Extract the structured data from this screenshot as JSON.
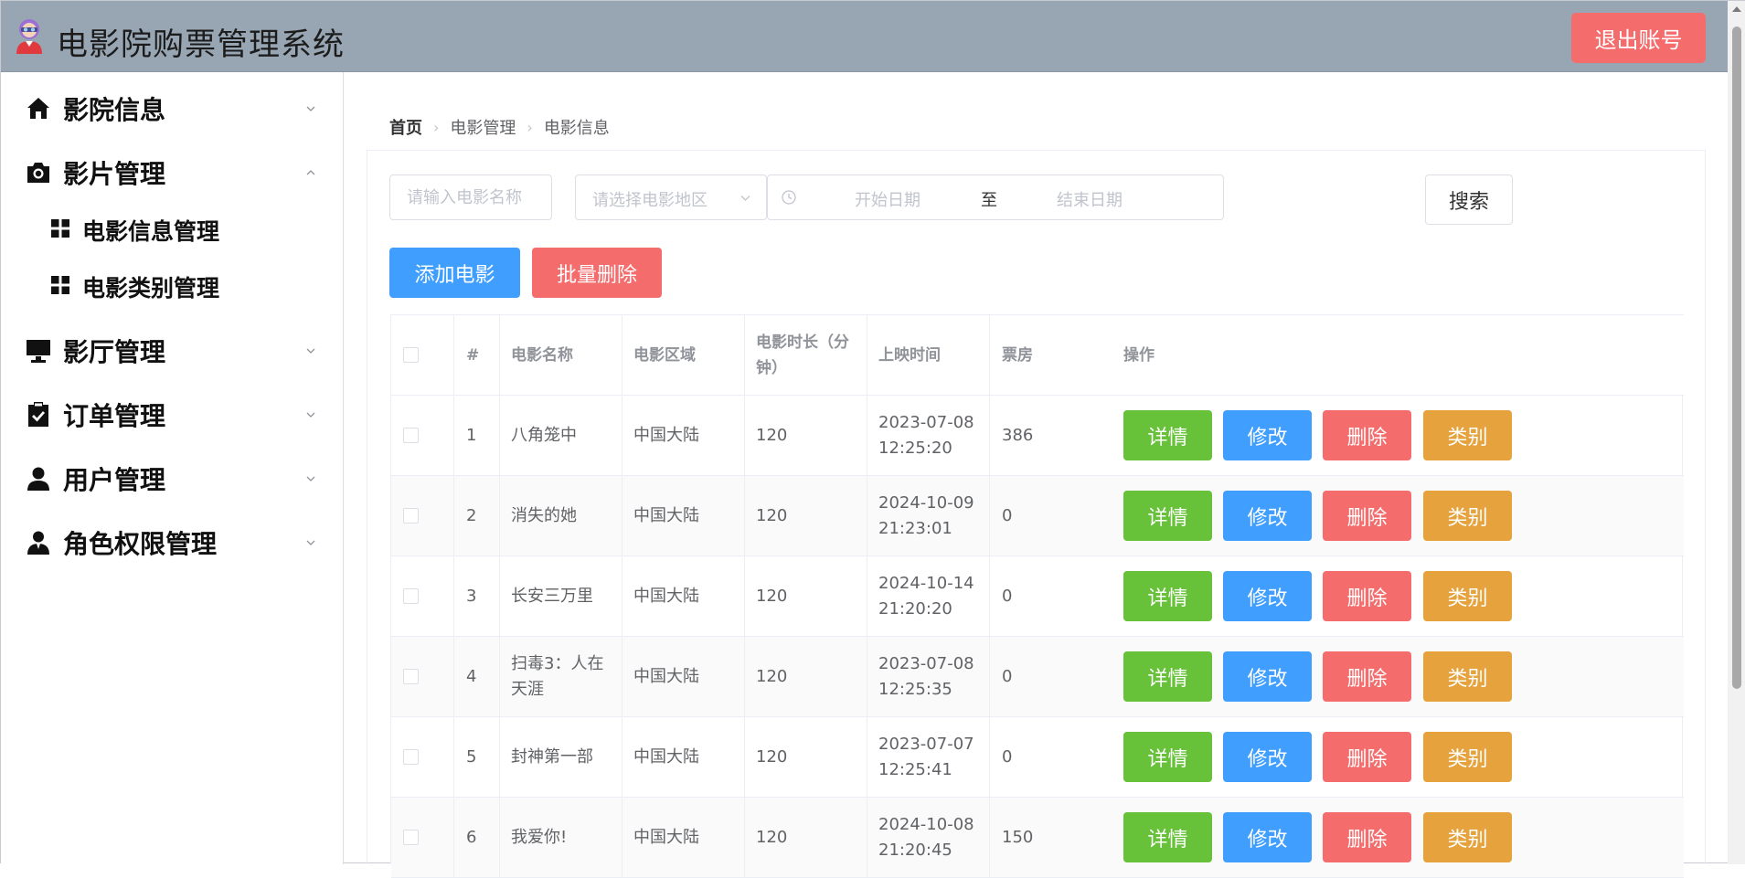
{
  "app": {
    "title": "电影院购票管理系统",
    "logout_label": "退出账号"
  },
  "sidebar": {
    "items": [
      {
        "label": "影院信息",
        "icon": "home-icon",
        "expanded": false
      },
      {
        "label": "影片管理",
        "icon": "camera-icon",
        "expanded": true
      },
      {
        "label": "影厅管理",
        "icon": "monitor-icon",
        "expanded": false
      },
      {
        "label": "订单管理",
        "icon": "clipboard-check-icon",
        "expanded": false
      },
      {
        "label": "用户管理",
        "icon": "user-icon",
        "expanded": false
      },
      {
        "label": "角色权限管理",
        "icon": "user-role-icon",
        "expanded": false
      }
    ],
    "sub_items": [
      {
        "label": "电影信息管理",
        "icon": "grid-icon"
      },
      {
        "label": "电影类别管理",
        "icon": "grid-icon"
      }
    ]
  },
  "breadcrumb": [
    "首页",
    "电影管理",
    "电影信息"
  ],
  "filters": {
    "name_placeholder": "请输入电影名称",
    "region_placeholder": "请选择电影地区",
    "start_placeholder": "开始日期",
    "range_separator": "至",
    "end_placeholder": "结束日期",
    "search_label": "搜索"
  },
  "actions": {
    "add_label": "添加电影",
    "batch_delete_label": "批量删除"
  },
  "table": {
    "columns": [
      "#",
      "电影名称",
      "电影区域",
      "电影时长（分钟）",
      "上映时间",
      "票房",
      "操作"
    ],
    "row_actions": [
      "详情",
      "修改",
      "删除",
      "类别"
    ],
    "rows": [
      {
        "index": "1",
        "name": "八角笼中",
        "region": "中国大陆",
        "duration": "120",
        "release": "2023-07-08 12:25:20",
        "box_office": "386"
      },
      {
        "index": "2",
        "name": "消失的她",
        "region": "中国大陆",
        "duration": "120",
        "release": "2024-10-09 21:23:01",
        "box_office": "0"
      },
      {
        "index": "3",
        "name": "长安三万里",
        "region": "中国大陆",
        "duration": "120",
        "release": "2024-10-14 21:20:20",
        "box_office": "0"
      },
      {
        "index": "4",
        "name": "扫毒3：人在天涯",
        "region": "中国大陆",
        "duration": "120",
        "release": "2023-07-08 12:25:35",
        "box_office": "0"
      },
      {
        "index": "5",
        "name": "封神第一部",
        "region": "中国大陆",
        "duration": "120",
        "release": "2023-07-07 12:25:41",
        "box_office": "0"
      },
      {
        "index": "6",
        "name": "我爱你!",
        "region": "中国大陆",
        "duration": "120",
        "release": "2024-10-08 21:20:45",
        "box_office": "150"
      }
    ]
  },
  "colors": {
    "header_bg": "#98a6b3",
    "primary": "#409eff",
    "success": "#67c23a",
    "danger": "#f56c6c",
    "warning": "#e6a23c"
  }
}
